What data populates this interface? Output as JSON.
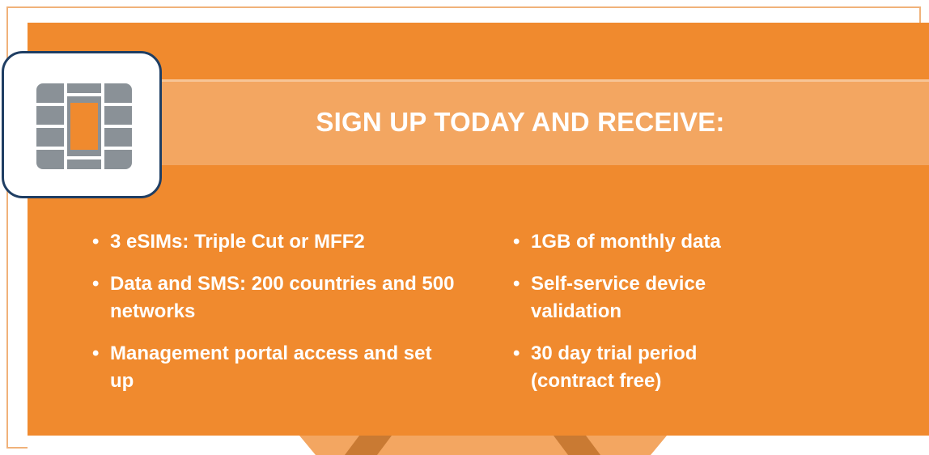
{
  "banner": {
    "title": "SIGN UP TODAY AND RECEIVE:"
  },
  "icons": {
    "sim": "sim-chip-icon"
  },
  "colors": {
    "panel": "#f08a2e",
    "banner": "#f3a661",
    "icon_border": "#1f3e63",
    "chip_gray": "#8a9197",
    "text": "#ffffff"
  },
  "benefits": {
    "left": [
      {
        "bullet": "•",
        "text": "3 eSIMs: Triple Cut or MFF2"
      },
      {
        "bullet": "•",
        "text": "Data and SMS: 200 countries and 500 networks"
      },
      {
        "bullet": "•",
        "text": "Management portal access and set up"
      }
    ],
    "right": [
      {
        "bullet": "•",
        "text": "1GB of monthly data"
      },
      {
        "bullet": "•",
        "text": "Self-service device validation"
      },
      {
        "bullet": "•",
        "text": "30 day trial period (contract free)"
      }
    ]
  }
}
